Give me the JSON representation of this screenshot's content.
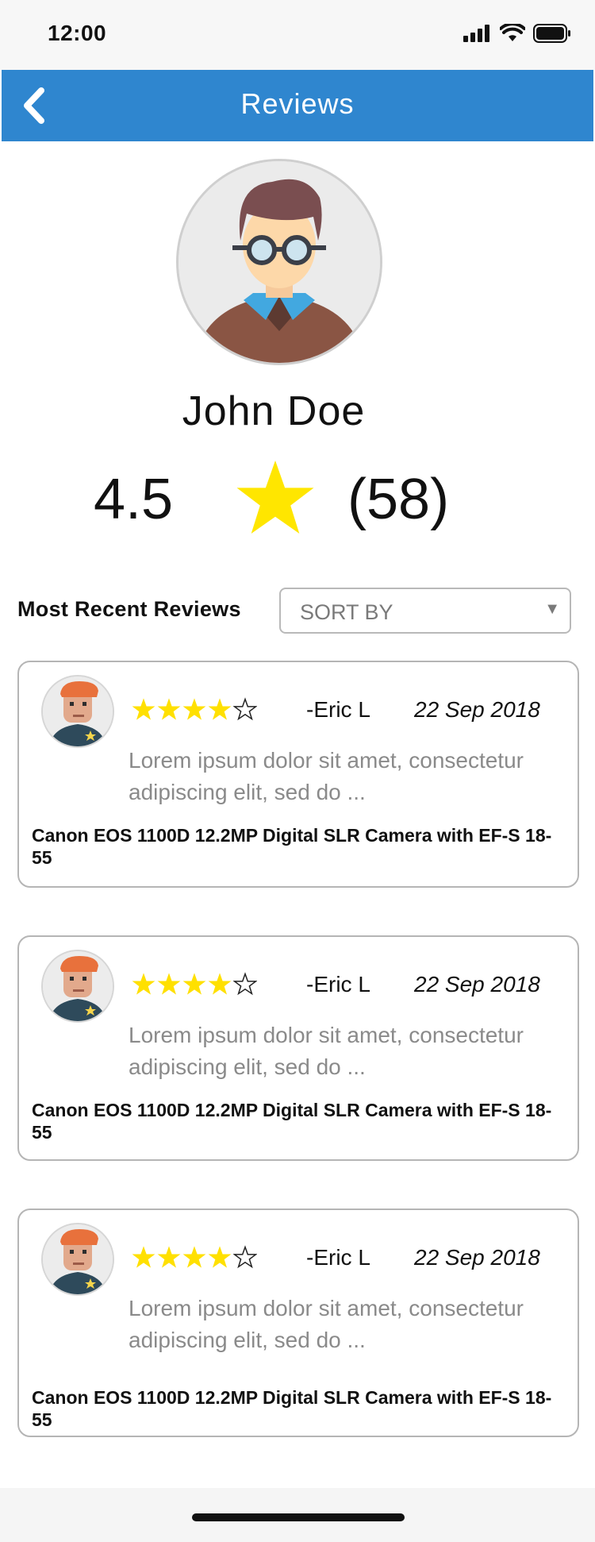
{
  "status_bar": {
    "time": "12:00",
    "icons": [
      "signal-icon",
      "wifi-icon",
      "battery-icon"
    ]
  },
  "nav": {
    "title": "Reviews",
    "back_icon": "chevron-left-icon",
    "background": "#2f86cf"
  },
  "profile": {
    "name": "John Doe",
    "rating": "4.5",
    "review_count": "(58)",
    "star_color": "#ffe600",
    "avatar_icon": "user-avatar-icon"
  },
  "reviews_section": {
    "title": "Most Recent Reviews",
    "sort": {
      "placeholder": "SORT BY",
      "arrow": "▼"
    }
  },
  "reviews": [
    {
      "stars": 4,
      "max_stars": 5,
      "reviewer": "-Eric L",
      "date": "22 Sep 2018",
      "text": "Lorem ipsum dolor sit amet, consectetur adipiscing elit, sed do ...",
      "product": "Canon EOS 1100D 12.2MP Digital SLR Camera with EF-S 18-55"
    },
    {
      "stars": 4,
      "max_stars": 5,
      "reviewer": "-Eric L",
      "date": "22 Sep 2018",
      "text": "Lorem ipsum dolor sit amet, consectetur adipiscing elit, sed do ...",
      "product": "Canon EOS 1100D 12.2MP Digital SLR Camera with EF-S 18-55"
    },
    {
      "stars": 4,
      "max_stars": 5,
      "reviewer": "-Eric L",
      "date": "22 Sep 2018",
      "text": "Lorem ipsum dolor sit amet, consectetur adipiscing elit, sed do ...",
      "product": "Canon EOS 1100D 12.2MP Digital SLR Camera with EF-S 18-55"
    }
  ]
}
